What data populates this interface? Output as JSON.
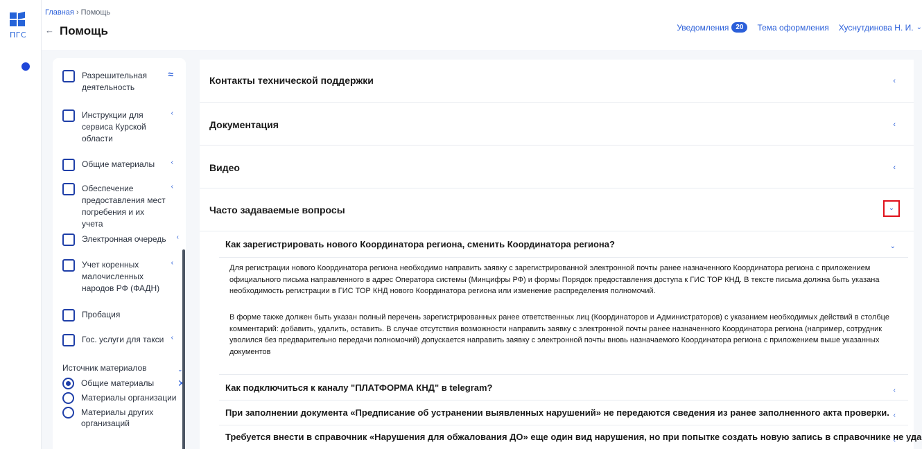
{
  "logo": {
    "text": "ПГС"
  },
  "breadcrumb": {
    "home": "Главная",
    "separator": "›",
    "current": "Помощь"
  },
  "page": {
    "back_icon": "←",
    "title": "Помощь"
  },
  "header": {
    "notifications_label": "Уведомления",
    "notifications_count": "20",
    "theme_label": "Тема оформления",
    "user_name": "Хуснутдинова Н. И.",
    "user_chevron": "⌄"
  },
  "filters": {
    "categories": [
      {
        "label": "Разрешительная деятельность",
        "chevron": "≈"
      },
      {
        "label": "Инструкции для сервиса Курской области",
        "chevron": "‹"
      },
      {
        "label": "Общие материалы",
        "chevron": "‹"
      },
      {
        "label": "Обеспечение предоставления мест погребения и их учета",
        "chevron": "‹"
      },
      {
        "label": "Электронная очередь",
        "chevron": "‹"
      },
      {
        "label": "Учет коренных малочисленных народов РФ (ФАДН)",
        "chevron": "‹"
      },
      {
        "label": "Пробация",
        "chevron": ""
      },
      {
        "label": "Гос. услуги для такси",
        "chevron": "‹"
      }
    ],
    "source_title": "Источник материалов",
    "source_chevron": "⌄",
    "sources": [
      {
        "label": "Общие материалы",
        "selected": true,
        "clear": "✕"
      },
      {
        "label": "Материалы организации",
        "selected": false,
        "clear": ""
      },
      {
        "label": "Материалы других организаций",
        "selected": false,
        "clear": ""
      }
    ]
  },
  "sections": [
    {
      "title": "Контакты технической поддержки",
      "chevron": "‹"
    },
    {
      "title": "Документация",
      "chevron": "‹"
    },
    {
      "title": "Видео",
      "chevron": "‹"
    },
    {
      "title": "Часто задаваемые вопросы",
      "chevron": "⌄"
    }
  ],
  "faq": [
    {
      "question": "Как зарегистрировать нового Координатора региона, сменить Координатора региона?",
      "chevron": "⌄",
      "answer_p1": "Для регистрации нового Координатора региона необходимо направить заявку с зарегистрированной электронной почты ранее назначенного Координатора региона с приложением официального письма направленного в адрес Оператора системы (Минцифры РФ) и формы Порядок предоставления доступа к ГИС ТОР КНД. В тексте письма должна быть указана необходимость регистрации в ГИС ТОР КНД нового Координатора региона или изменение распределения полномочий.",
      "answer_p2": "В форме также должен быть указан полный перечень зарегистрированных ранее ответственных лиц (Координаторов и Администраторов) с указанием необходимых действий в столбце комментарий: добавить, удалить, оставить. В случае отсутствия возможности направить заявку с электронной почты ранее назначенного Координатора региона (например, сотрудник уволился без предварительно передачи полномочий) допускается направить заявку с электронной почты вновь назначаемого Координатора региона с приложением выше указанных документов"
    },
    {
      "question": "Как подключиться к каналу \"ПЛАТФОРМА КНД\" в telegram?",
      "chevron": "‹"
    },
    {
      "question": "При заполнении документа «Предписание об устранении выявленных нарушений» не передаются сведения из ранее заполненного акта проверки.",
      "chevron": "‹"
    },
    {
      "question": "Требуется внести в справочник «Нарушения для обжалования ДО» еще один вид нарушения, но при попытке создать новую запись в справочнике не удается",
      "chevron": "‹"
    }
  ],
  "colors": {
    "accent": "#2b5fd9",
    "checkbox": "#1f3fa8",
    "highlight": "#e0101a",
    "background": "#f5f7fa"
  }
}
